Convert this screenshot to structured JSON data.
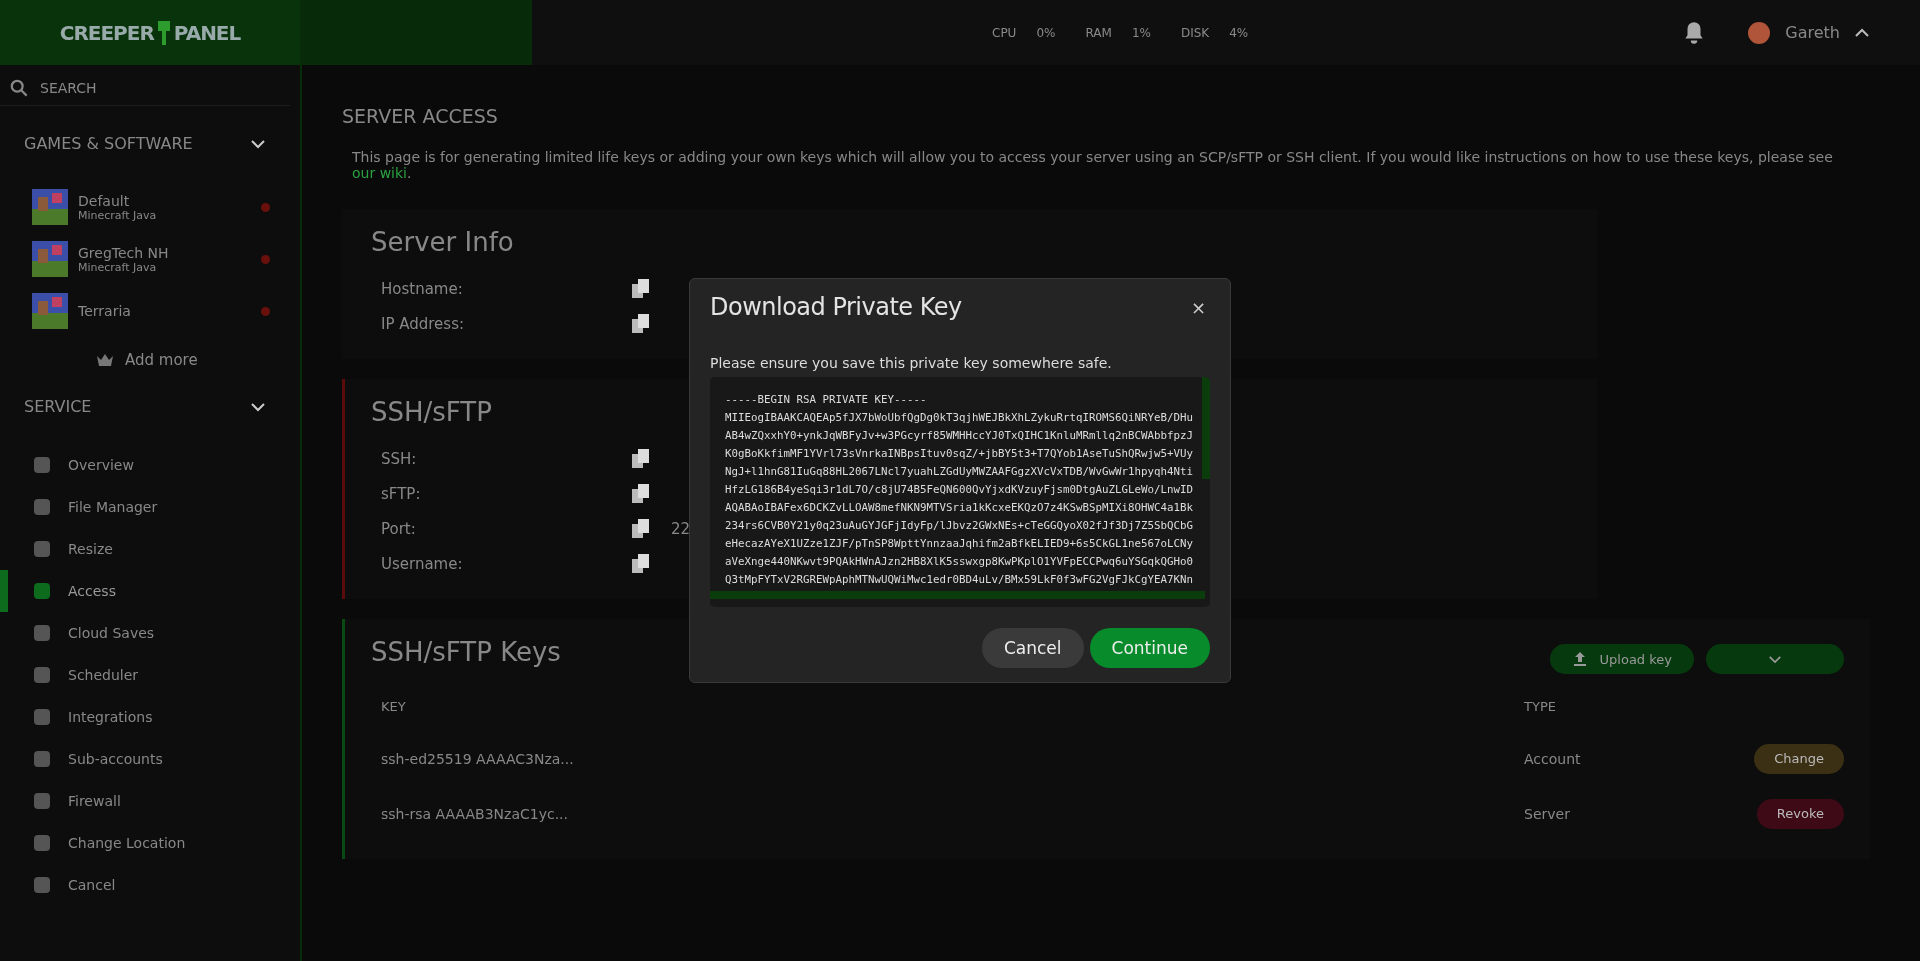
{
  "header": {
    "logo_left": "CREEPER",
    "logo_right": "PANEL",
    "stats": [
      {
        "label": "CPU",
        "value": "0%"
      },
      {
        "label": "RAM",
        "value": "1%"
      },
      {
        "label": "DISK",
        "value": "4%"
      }
    ],
    "user": "Gareth"
  },
  "sidebar": {
    "search": {
      "placeholder": "SEARCH"
    },
    "games_heading": "GAMES & SOFTWARE",
    "servers": [
      {
        "name": "Default",
        "game": "Minecraft Java",
        "online": false
      },
      {
        "name": "GregTech NH",
        "game": "Minecraft Java",
        "online": false
      },
      {
        "name": "Terraria",
        "online": false
      }
    ],
    "add_more": "Add more",
    "service_heading": "SERVICE",
    "menu": [
      {
        "label": "Overview",
        "selected": false
      },
      {
        "label": "File Manager",
        "selected": false
      },
      {
        "label": "Resize",
        "selected": false
      },
      {
        "label": "Access",
        "selected": true
      },
      {
        "label": "Cloud Saves",
        "selected": false
      },
      {
        "label": "Scheduler",
        "selected": false
      },
      {
        "label": "Integrations",
        "selected": false
      },
      {
        "label": "Sub-accounts",
        "selected": false
      },
      {
        "label": "Firewall",
        "selected": false
      },
      {
        "label": "Change Location",
        "selected": false
      },
      {
        "label": "Cancel",
        "selected": false
      }
    ]
  },
  "page": {
    "title": "SERVER ACCESS",
    "intro": "This page is for generating limited life keys or adding your own keys which will allow you to access your server using an SCP/sFTP or SSH client. If you would like instructions on how to use these keys, please see",
    "intro_link": "our wiki",
    "intro_end": ".",
    "server_info": {
      "title": "Server Info",
      "fields": [
        "Hostname:",
        "IP Address:"
      ]
    },
    "ssh": {
      "title": "SSH/sFTP",
      "fields": [
        {
          "label": "SSH:"
        },
        {
          "label": "sFTP:"
        },
        {
          "label": "Port:",
          "value": "22"
        },
        {
          "label": "Username:"
        }
      ]
    },
    "keys": {
      "title": "SSH/sFTP Keys",
      "upload": "Upload key",
      "columns": [
        "KEY",
        "TYPE"
      ],
      "rows": [
        {
          "key": "ssh-ed25519 AAAAC3Nza...",
          "type": "Account",
          "action": "Change",
          "kind": "change"
        },
        {
          "key": "ssh-rsa AAAAB3NzaC1yc...",
          "type": "Server",
          "action": "Revoke",
          "kind": "revoke"
        }
      ]
    }
  },
  "dialog": {
    "title": "Download Private Key",
    "close": "×",
    "message": "Please ensure you save this private key somewhere safe.",
    "key_lines": [
      "-----BEGIN RSA PRIVATE KEY-----",
      "MIIEogIBAAKCAQEAp5fJX7bWoUbfQgDg0kT3qjhWEJBkXhLZykuRrtqIROMS6QiNRYeB/DHu",
      "AB4wZQxxhY0+ynkJqWBFyJv+w3PGcyrf85WMHHccYJ0TxQIHC1KnluMRmllq2nBCWAbbfpzJ",
      "K0gBoKkfimMF1YVrl73sVnrkaINBpsItuv0sqZ/+jbBY5t3+T7QYob1AseTuShQRwjw5+VUy",
      "NgJ+l1hnG81IuGq88HL2067LNcl7yuahLZGdUyMWZAAFGgzXVcVxTDB/WvGwWr1hpyqh4Nti",
      "HfzLG186B4yeSqi3r1dL7O/c8jU74B5FeQN600QvYjxdKVzuyFjsm0DtgAuZLGLeWo/LnwID",
      "AQABAoIBAFex6DCKZvLLOAW8mefNKN9MTVSria1kKcxeEKQzO7z4KSwBSpMIXi8OHWC4a1Bk",
      "234rs6CVB0Y21y0q23uAuGYJGFjIdyFp/lJbvz2GWxNEs+cTeGGQyoX02fJf3Dj7Z5SbQCbG",
      "eHecazAYeX1UZze1ZJF/pTnSP8WpttYnnzaaJqhifm2aBfkELIED9+6s5CkGL1ne567oLCNy",
      "aVeXnge440NKwvt9PQAkHWnAJzn2HB8XlK5sswxgp8KwPKplO1YVFpECCPwq6uYSGqkQGHo0",
      "Q3tMpFYTxV2RGREWpAphMTNwUQWiMwc1edr0BD4uLv/BMx59LkF0f3wFG2VgFJkCgYEA7KNn"
    ],
    "buttons": [
      {
        "label": "Cancel",
        "kind": "secondary"
      },
      {
        "label": "Continue",
        "kind": "primary"
      }
    ]
  }
}
